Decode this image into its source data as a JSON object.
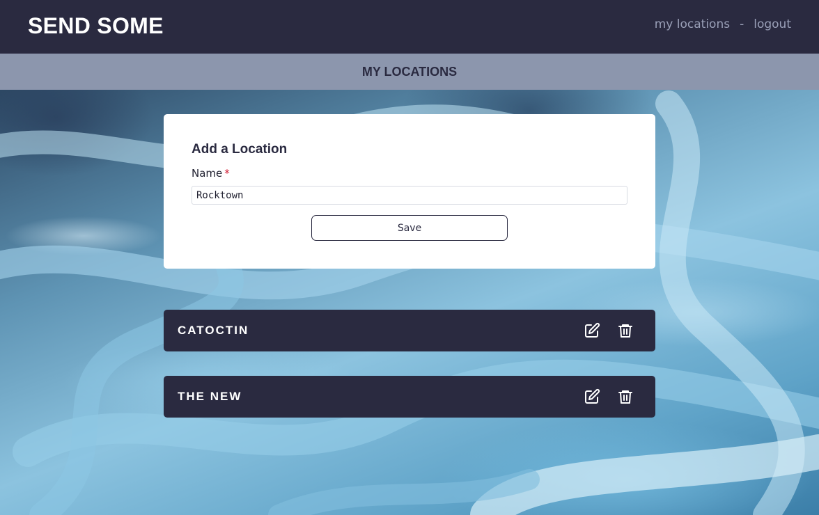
{
  "header": {
    "brand": "SEND SOME",
    "nav": {
      "my_locations": "my locations",
      "separator": "-",
      "logout": "logout"
    }
  },
  "subheader": {
    "title": "MY LOCATIONS"
  },
  "form": {
    "title": "Add a Location",
    "name_label": "Name",
    "required_mark": "*",
    "name_value": "Rocktown",
    "save_label": "Save"
  },
  "locations": [
    {
      "name": "CATOCTIN",
      "edit_icon": "edit-icon",
      "delete_icon": "trash-icon"
    },
    {
      "name": "THE NEW",
      "edit_icon": "edit-icon",
      "delete_icon": "trash-icon"
    }
  ],
  "colors": {
    "header_bg": "#2a2a40",
    "subheader_bg": "#8c96ad",
    "card_bg": "#ffffff",
    "required": "#d0182f"
  }
}
